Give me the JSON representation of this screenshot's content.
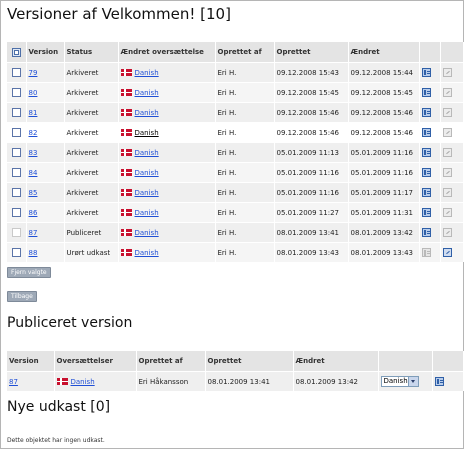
{
  "title": "Versioner af Velkommen! [10]",
  "versions_table": {
    "headers": [
      "Version",
      "Status",
      "Ændret oversættelse",
      "Oprettet af",
      "Oprettet",
      "Ændret"
    ],
    "rows": [
      {
        "version": "79",
        "status": "Arkiveret",
        "language": "Danish",
        "created_by": "Eri H.",
        "created": "09.12.2008 15:43",
        "changed": "09.12.2008 15:44"
      },
      {
        "version": "80",
        "status": "Arkiveret",
        "language": "Danish",
        "created_by": "Eri H.",
        "created": "09.12.2008 15:45",
        "changed": "09.12.2008 15:45"
      },
      {
        "version": "81",
        "status": "Arkiveret",
        "language": "Danish",
        "created_by": "Eri H.",
        "created": "09.12.2008 15:46",
        "changed": "09.12.2008 15:46"
      },
      {
        "version": "82",
        "status": "Arkiveret",
        "language": "Danish",
        "created_by": "Eri H.",
        "created": "09.12.2008 15:46",
        "changed": "09.12.2008 15:46"
      },
      {
        "version": "83",
        "status": "Arkiveret",
        "language": "Danish",
        "created_by": "Eri H.",
        "created": "05.01.2009 11:13",
        "changed": "05.01.2009 11:16"
      },
      {
        "version": "84",
        "status": "Arkiveret",
        "language": "Danish",
        "created_by": "Eri H.",
        "created": "05.01.2009 11:16",
        "changed": "05.01.2009 11:16"
      },
      {
        "version": "85",
        "status": "Arkiveret",
        "language": "Danish",
        "created_by": "Eri H.",
        "created": "05.01.2009 11:16",
        "changed": "05.01.2009 11:17"
      },
      {
        "version": "86",
        "status": "Arkiveret",
        "language": "Danish",
        "created_by": "Eri H.",
        "created": "05.01.2009 11:27",
        "changed": "05.01.2009 11:31"
      },
      {
        "version": "87",
        "status": "Publiceret",
        "language": "Danish",
        "created_by": "Eri H.",
        "created": "08.01.2009 13:41",
        "changed": "08.01.2009 13:42"
      },
      {
        "version": "88",
        "status": "Urørt udkast",
        "language": "Danish",
        "created_by": "Eri H.",
        "created": "08.01.2009 13:43",
        "changed": "08.01.2009 13:43"
      }
    ]
  },
  "remove_selected_label": "Fjern valgte",
  "back_label": "Tilbage",
  "published_section": {
    "title": "Publiceret version",
    "headers": [
      "Version",
      "Oversættelser",
      "Oprettet af",
      "Oprettet",
      "Ændret"
    ],
    "row": {
      "version": "87",
      "language": "Danish",
      "created_by": "Eri Håkansson",
      "created": "08.01.2009 13:41",
      "changed": "08.01.2009 13:42",
      "select_value": "Danish"
    }
  },
  "drafts_section": {
    "title": "Nye udkast [0]",
    "empty_text": "Dette objektet har ingen udkast."
  },
  "colors": {
    "link": "#1f4fd6",
    "header_bg": "#e4e4e4",
    "button_bg": "#9ea9b7",
    "flag_red": "#c8102e"
  }
}
